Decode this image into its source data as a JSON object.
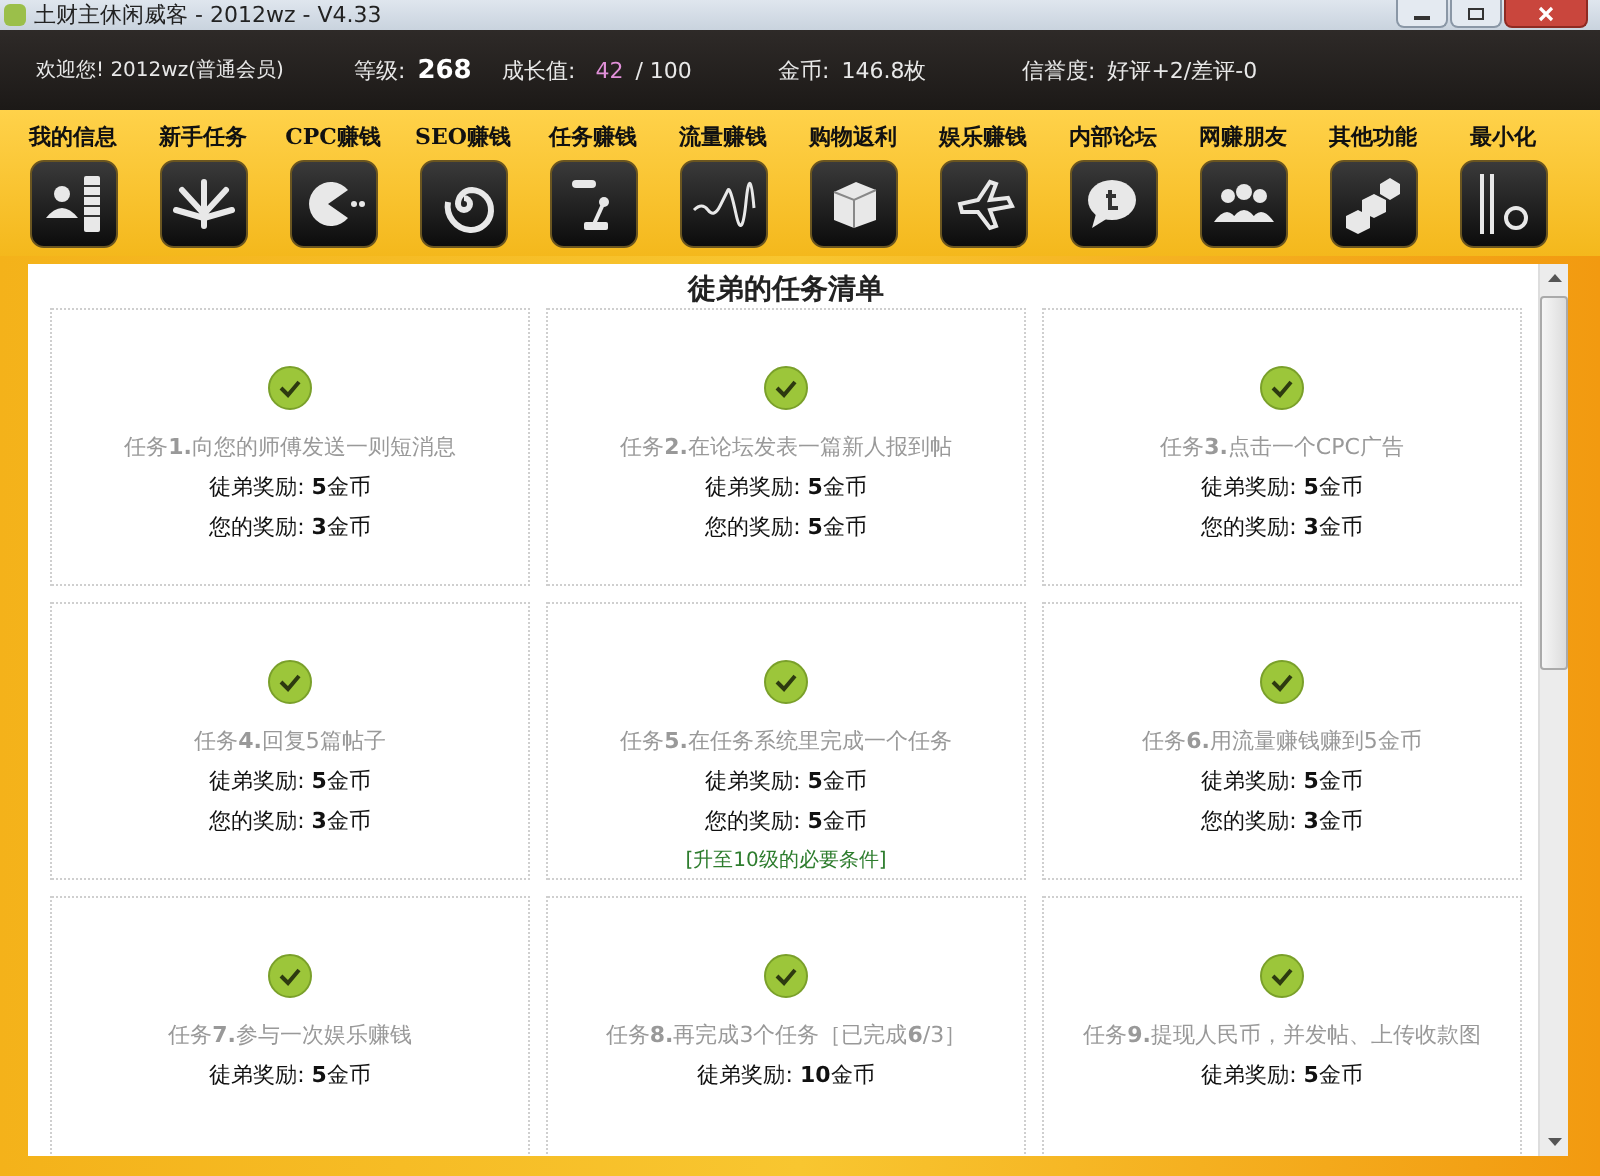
{
  "window": {
    "title": "土财主休闲威客 - 2012wz - V4.33"
  },
  "info_bar": {
    "welcome": "欢迎您!  2012wz(普通会员)",
    "level_label": "等级:",
    "level_value": "268",
    "growth_label": "成长值:",
    "growth_value": "42",
    "growth_max": "/ 100",
    "gold_label": "金币:",
    "gold_value": "146.8枚",
    "reputation_label": "信誉度:",
    "reputation_value": "好评+2/差评-0"
  },
  "nav": [
    {
      "label": "我的信息"
    },
    {
      "label": "新手任务"
    },
    {
      "label": "CPC赚钱"
    },
    {
      "label": "SEO赚钱"
    },
    {
      "label": "任务赚钱"
    },
    {
      "label": "流量赚钱"
    },
    {
      "label": "购物返利"
    },
    {
      "label": "娱乐赚钱"
    },
    {
      "label": "内部论坛"
    },
    {
      "label": "网赚朋友"
    },
    {
      "label": "其他功能"
    },
    {
      "label": "最小化"
    }
  ],
  "panel": {
    "title": "徒弟的任务清单"
  },
  "tasks": [
    {
      "title": "任务**1.**向您的师傅发送一则短消息",
      "completed": true,
      "rewards": [
        "徒弟奖励: **5**金币",
        "您的奖励: **3**金币"
      ]
    },
    {
      "title": "任务**2.**在论坛发表一篇新人报到帖",
      "completed": true,
      "rewards": [
        "徒弟奖励: **5**金币",
        "您的奖励: **5**金币"
      ]
    },
    {
      "title": "任务**3.**点击一个CPC广告",
      "completed": true,
      "rewards": [
        "徒弟奖励: **5**金币",
        "您的奖励: **3**金币"
      ]
    },
    {
      "title": "任务**4.**回复5篇帖子",
      "completed": true,
      "rewards": [
        "徒弟奖励: **5**金币",
        "您的奖励: **3**金币"
      ]
    },
    {
      "title": "任务**5.**在任务系统里完成一个任务",
      "completed": true,
      "rewards": [
        "徒弟奖励: **5**金币",
        "您的奖励: **5**金币"
      ],
      "note": "[升至10级的必要条件]"
    },
    {
      "title": "任务**6.**用流量赚钱赚到5金币",
      "completed": true,
      "rewards": [
        "徒弟奖励: **5**金币",
        "您的奖励: **3**金币"
      ]
    },
    {
      "title": "任务**7.**参与一次娱乐赚钱",
      "completed": true,
      "rewards": [
        "徒弟奖励: **5**金币"
      ]
    },
    {
      "title": "任务**8.**再完成3个任务［已完成**6**/3］",
      "completed": true,
      "rewards": [
        "徒弟奖励: **10**金币"
      ]
    },
    {
      "title": "任务**9.**提现人民币，并发帖、上传收款图",
      "completed": true,
      "rewards": [
        "徒弟奖励: **5**金币"
      ]
    }
  ]
}
